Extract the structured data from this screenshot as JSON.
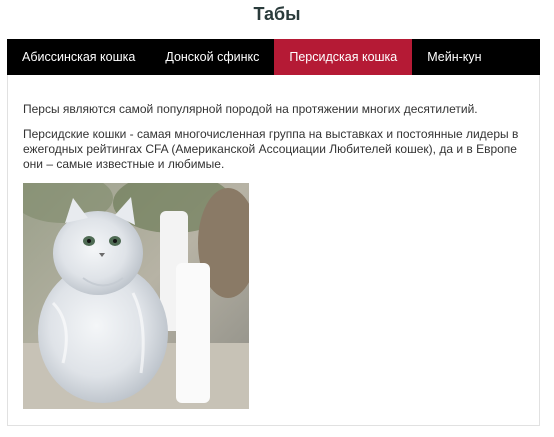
{
  "page": {
    "title": "Табы"
  },
  "tabs": [
    {
      "label": "Абиссинская кошка",
      "active": false
    },
    {
      "label": "Донской сфинкс",
      "active": false
    },
    {
      "label": "Персидская кошка",
      "active": true
    },
    {
      "label": "Мейн-кун",
      "active": false
    }
  ],
  "content": {
    "paragraph_1": "Персы являются самой популярной породой на протяжении многих десятилетий.",
    "paragraph_2": "Персидские кошки - самая многочисленная группа на выставках и постоянные лидеры в ежегодных рейтингах CFA (Американской Ассоциации Любителей кошек), да и в Европе они – самые известные и любимые.",
    "image_subject": "persian-cat-photo"
  },
  "colors": {
    "tab_bar": "#000000",
    "tab_active": "#b51a35",
    "title": "#2a3b3b"
  }
}
